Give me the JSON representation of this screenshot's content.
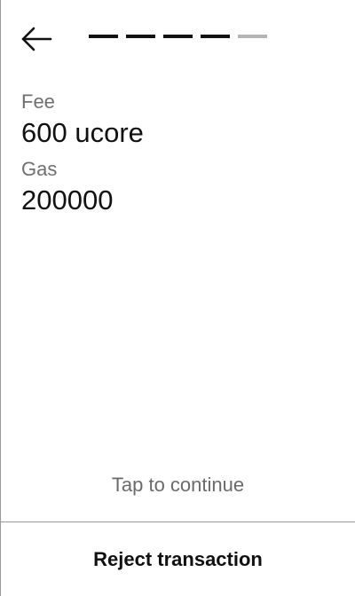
{
  "header": {
    "back_icon": "arrow-left-icon",
    "progress": {
      "total_steps": 5,
      "completed_steps": 4,
      "active_color": "#111111",
      "pending_color": "#b5b5b5"
    }
  },
  "details": {
    "fee_label": "Fee",
    "fee_value": "600 ucore",
    "gas_label": "Gas",
    "gas_value": "200000"
  },
  "hint": "Tap to continue",
  "actions": {
    "reject_label": "Reject transaction"
  }
}
